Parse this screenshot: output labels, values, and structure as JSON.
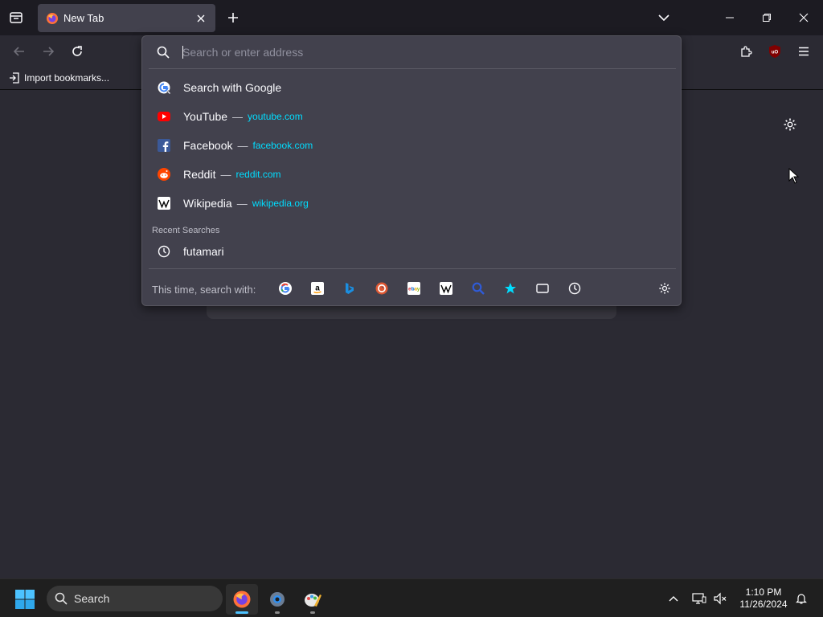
{
  "tab": {
    "title": "New Tab"
  },
  "bookmarks": {
    "import_label": "Import bookmarks..."
  },
  "urlbar": {
    "placeholder": "Search or enter address",
    "results": [
      {
        "title": "Search with Google",
        "url": "",
        "icon": "google-icon"
      },
      {
        "title": "YouTube",
        "url": "youtube.com",
        "icon": "youtube-icon"
      },
      {
        "title": "Facebook",
        "url": "facebook.com",
        "icon": "facebook-icon"
      },
      {
        "title": "Reddit",
        "url": "reddit.com",
        "icon": "reddit-icon"
      },
      {
        "title": "Wikipedia",
        "url": "wikipedia.org",
        "icon": "wikipedia-icon"
      }
    ],
    "separator": "—",
    "recent_label": "Recent Searches",
    "recent": [
      {
        "title": "futamari",
        "icon": "history-icon"
      }
    ],
    "oneoff_label": "This time, search with:",
    "engines": [
      "google",
      "amazon",
      "bing",
      "duckduckgo",
      "ebay",
      "wikipedia",
      "search",
      "bookmarks",
      "tabs",
      "history"
    ]
  },
  "taskbar": {
    "search_label": "Search"
  },
  "clock": {
    "time": "1:10 PM",
    "date": "11/26/2024"
  },
  "colors": {
    "accent": "#00ddff",
    "panel": "#42414d",
    "chrome": "#1c1b22",
    "page": "#2b2a33"
  }
}
